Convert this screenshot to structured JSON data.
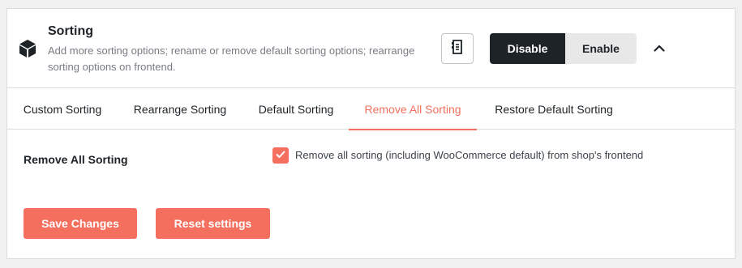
{
  "module": {
    "title": "Sorting",
    "description": "Add more sorting options; rename or remove default sorting options; rearrange sorting options on frontend.",
    "icon": "cube-icon"
  },
  "header_actions": {
    "disable_label": "Disable",
    "enable_label": "Enable",
    "active_state": "Disable"
  },
  "tabs": [
    {
      "label": "Custom Sorting",
      "active": false
    },
    {
      "label": "Rearrange Sorting",
      "active": false
    },
    {
      "label": "Default Sorting",
      "active": false
    },
    {
      "label": "Remove All Sorting",
      "active": true
    },
    {
      "label": "Restore Default Sorting",
      "active": false
    }
  ],
  "settings": {
    "remove_all": {
      "label": "Remove All Sorting",
      "checked": true,
      "checkbox_label": "Remove all sorting (including WooCommerce default) from shop's frontend"
    }
  },
  "actions": {
    "save_label": "Save Changes",
    "reset_label": "Reset settings"
  },
  "colors": {
    "accent": "#f46f5e",
    "dark": "#1d2327",
    "muted": "#787c82"
  }
}
